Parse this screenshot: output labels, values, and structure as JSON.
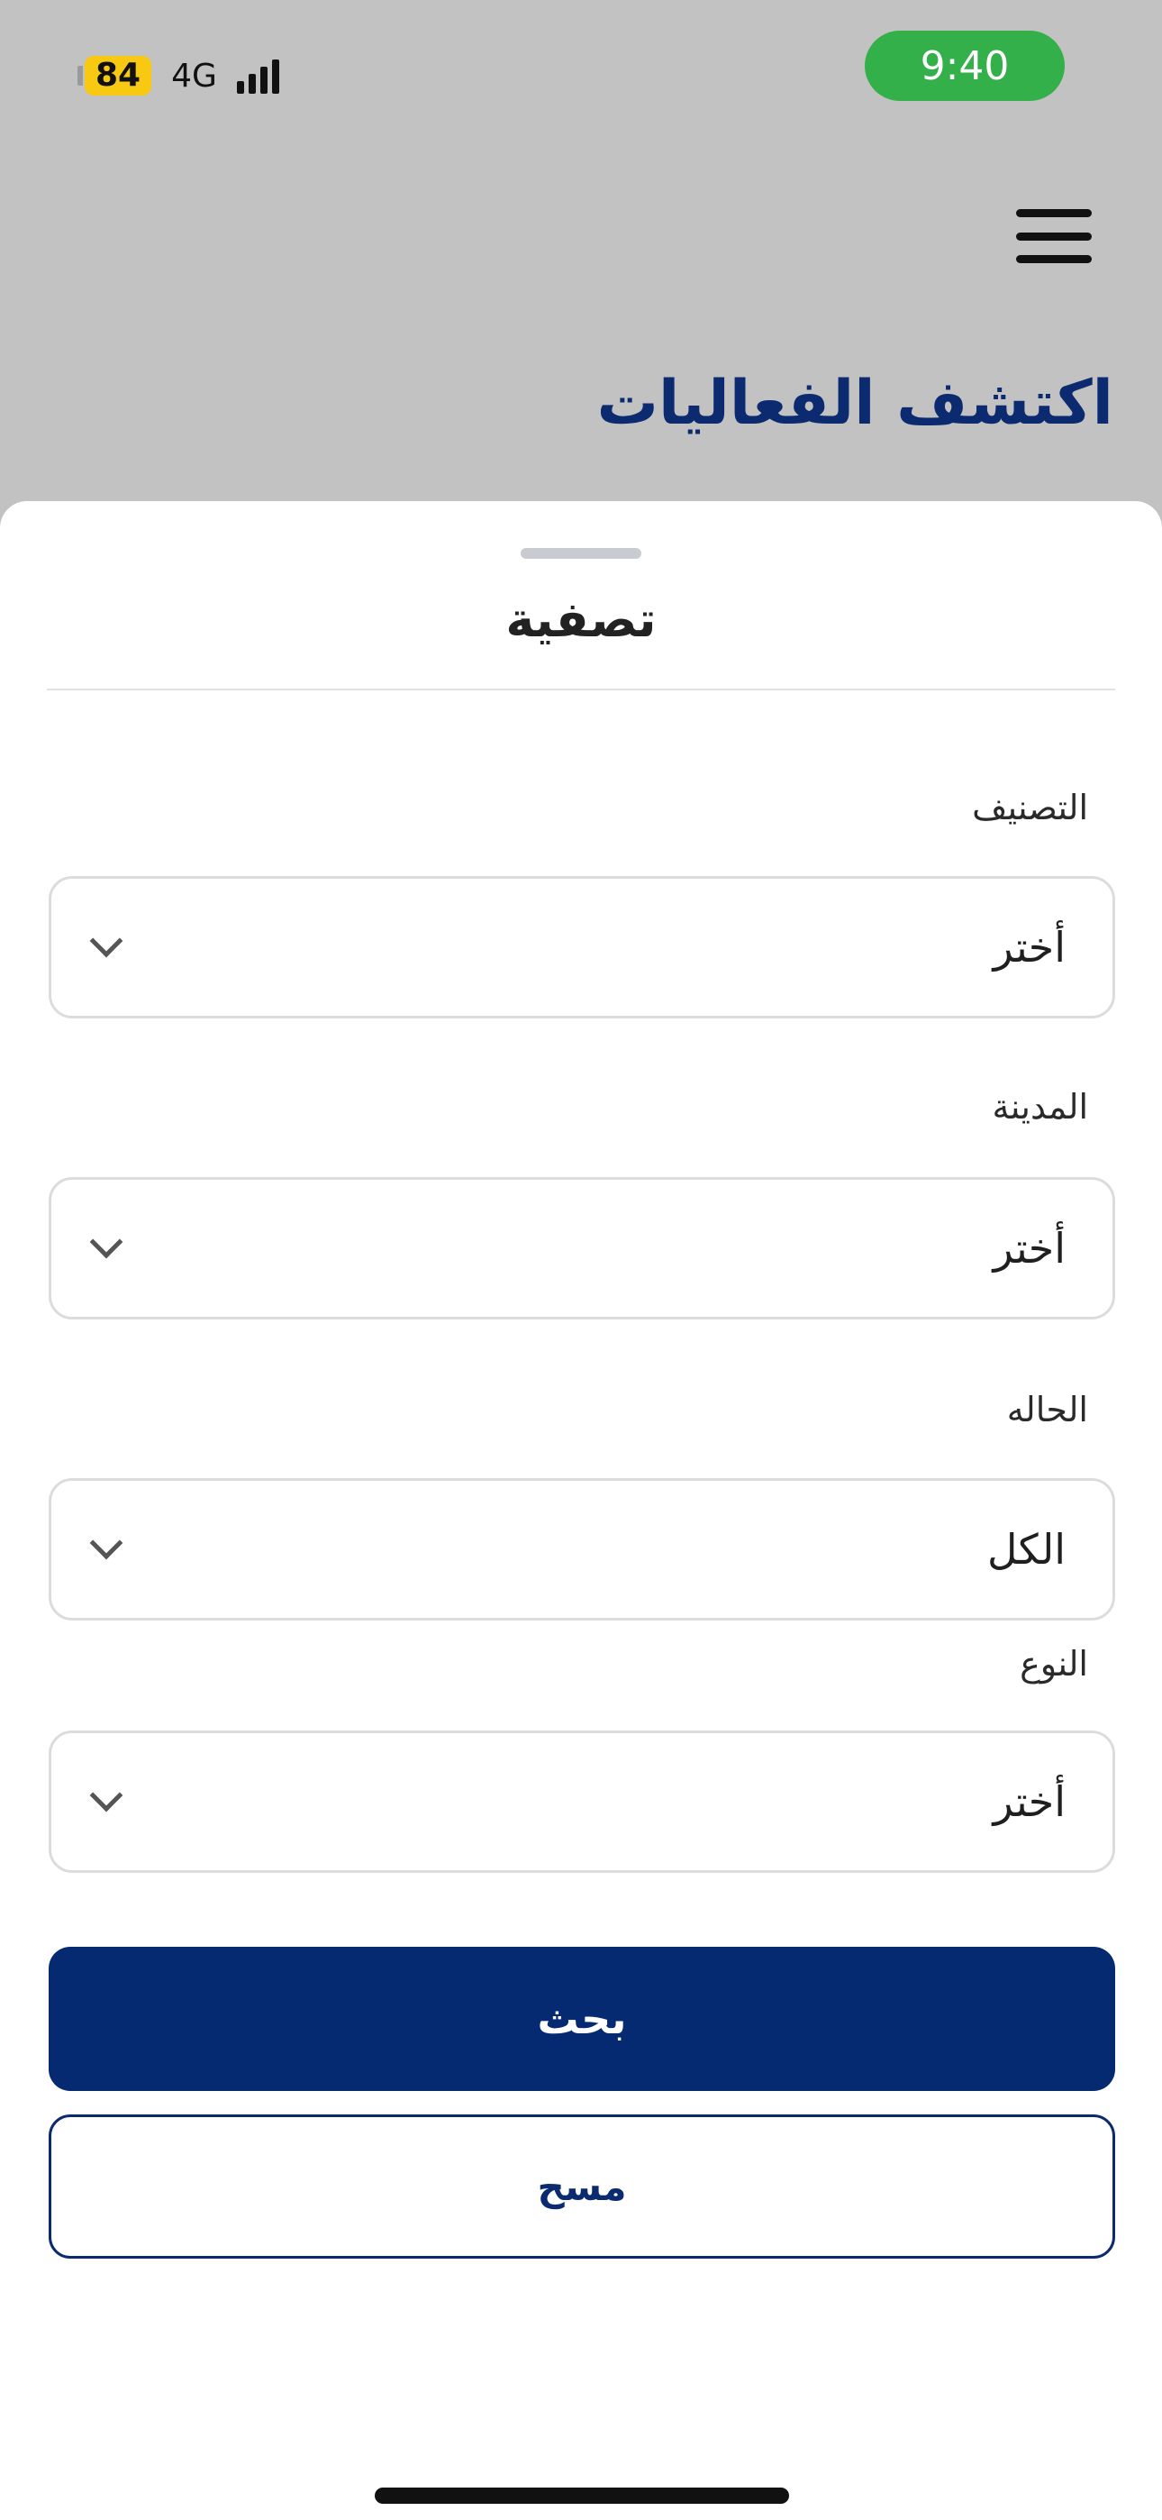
{
  "status_bar": {
    "battery": "84",
    "network": "4G",
    "time": "9:40",
    "colors": {
      "battery": "#f7c912",
      "time_pill": "#33b04a"
    }
  },
  "header": {
    "title": "اكتشف الفعاليات",
    "menu_icon": "hamburger-menu-icon"
  },
  "sheet": {
    "title": "تصفية",
    "fields": [
      {
        "label": "التصنيف",
        "value": "أختر"
      },
      {
        "label": "المدينة",
        "value": "أختر"
      },
      {
        "label": "الحاله",
        "value": "الكل"
      },
      {
        "label": "النوع",
        "value": "أختر"
      }
    ],
    "search_button": "بحث",
    "clear_button": "مسح",
    "colors": {
      "primary": "#062a72",
      "title": "#0b2a6f"
    }
  }
}
